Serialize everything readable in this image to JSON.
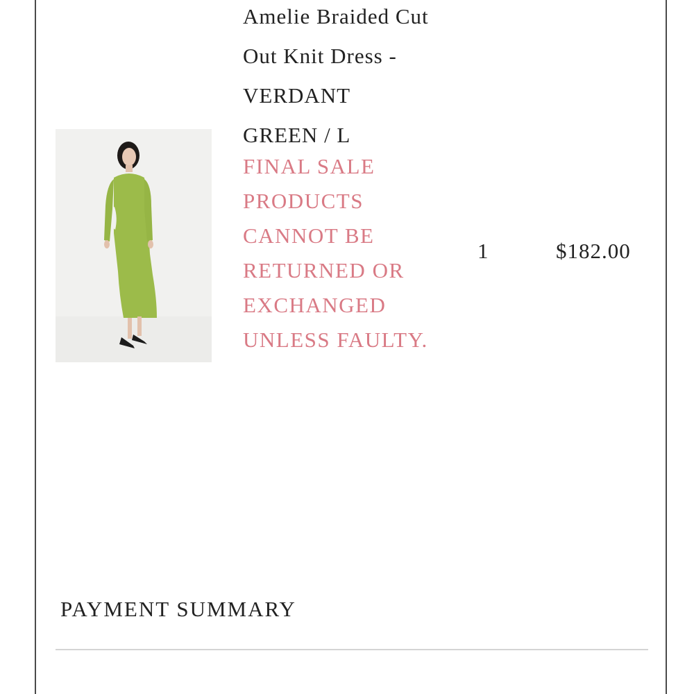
{
  "line_item": {
    "product_name": "Amelie Braided Cut Out Knit Dress - VERDANT GREEN / L",
    "final_sale_notice": "FINAL SALE PRODUCTS CANNOT BE RETURNED OR EXCHANGED UNLESS FAULTY.",
    "quantity": "1",
    "price": "$182.00",
    "image_alt": "Amelie Braided Cut Out Knit Dress in verdant green",
    "dress_color": "#9cbb4a"
  },
  "payment_summary": {
    "heading": "PAYMENT SUMMARY"
  },
  "colors": {
    "notice": "#d97a85",
    "text": "#222222",
    "border": "#4a4a4a",
    "divider": "#d4d4d4"
  }
}
